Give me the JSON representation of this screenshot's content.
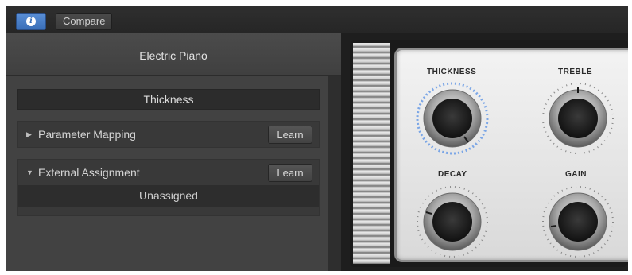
{
  "toolbar": {
    "info_icon": "info-icon",
    "info_glyph": "i",
    "compare_label": "Compare"
  },
  "panel": {
    "title": "Electric Piano",
    "parameter_name": "Thickness",
    "parameter_mapping": {
      "label": "Parameter Mapping",
      "learn_label": "Learn",
      "expanded": false
    },
    "external_assignment": {
      "label": "External Assignment",
      "learn_label": "Learn",
      "expanded": true,
      "value": "Unassigned"
    }
  },
  "plugin": {
    "knobs": [
      {
        "id": "thickness",
        "label": "THICKNESS",
        "highlighted": true
      },
      {
        "id": "treble",
        "label": "TREBLE",
        "highlighted": false
      },
      {
        "id": "decay",
        "label": "DECAY",
        "highlighted": false
      },
      {
        "id": "gain",
        "label": "GAIN",
        "highlighted": false
      }
    ]
  },
  "colors": {
    "accent": "#3a6fb8",
    "highlight_ring": "#6f9fe6"
  }
}
